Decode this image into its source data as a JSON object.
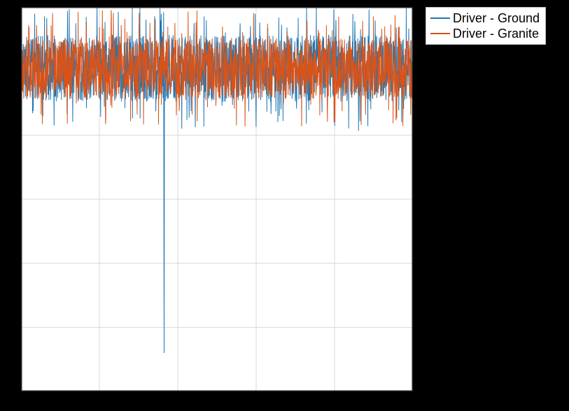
{
  "chart_data": {
    "type": "line",
    "title": "",
    "xlabel": "",
    "ylabel": "",
    "xlim": [
      0,
      50
    ],
    "ylim": [
      -1.0,
      0.5
    ],
    "grid": true,
    "legend_position": "outside-right-top",
    "series": [
      {
        "name": "Driver - Ground",
        "color": "#1f77b4",
        "noise_center": 0.26,
        "noise_amplitude": 0.13,
        "spikes": [
          {
            "x": 18.2,
            "ymin": -0.85,
            "ymax": 0.48
          }
        ]
      },
      {
        "name": "Driver - Granite",
        "color": "#d95319",
        "noise_center": 0.26,
        "noise_amplitude": 0.12,
        "spikes": []
      }
    ]
  },
  "legend": {
    "items": [
      {
        "label": "Driver - Ground",
        "color": "#1f77b4"
      },
      {
        "label": "Driver - Granite",
        "color": "#d95319"
      }
    ]
  }
}
